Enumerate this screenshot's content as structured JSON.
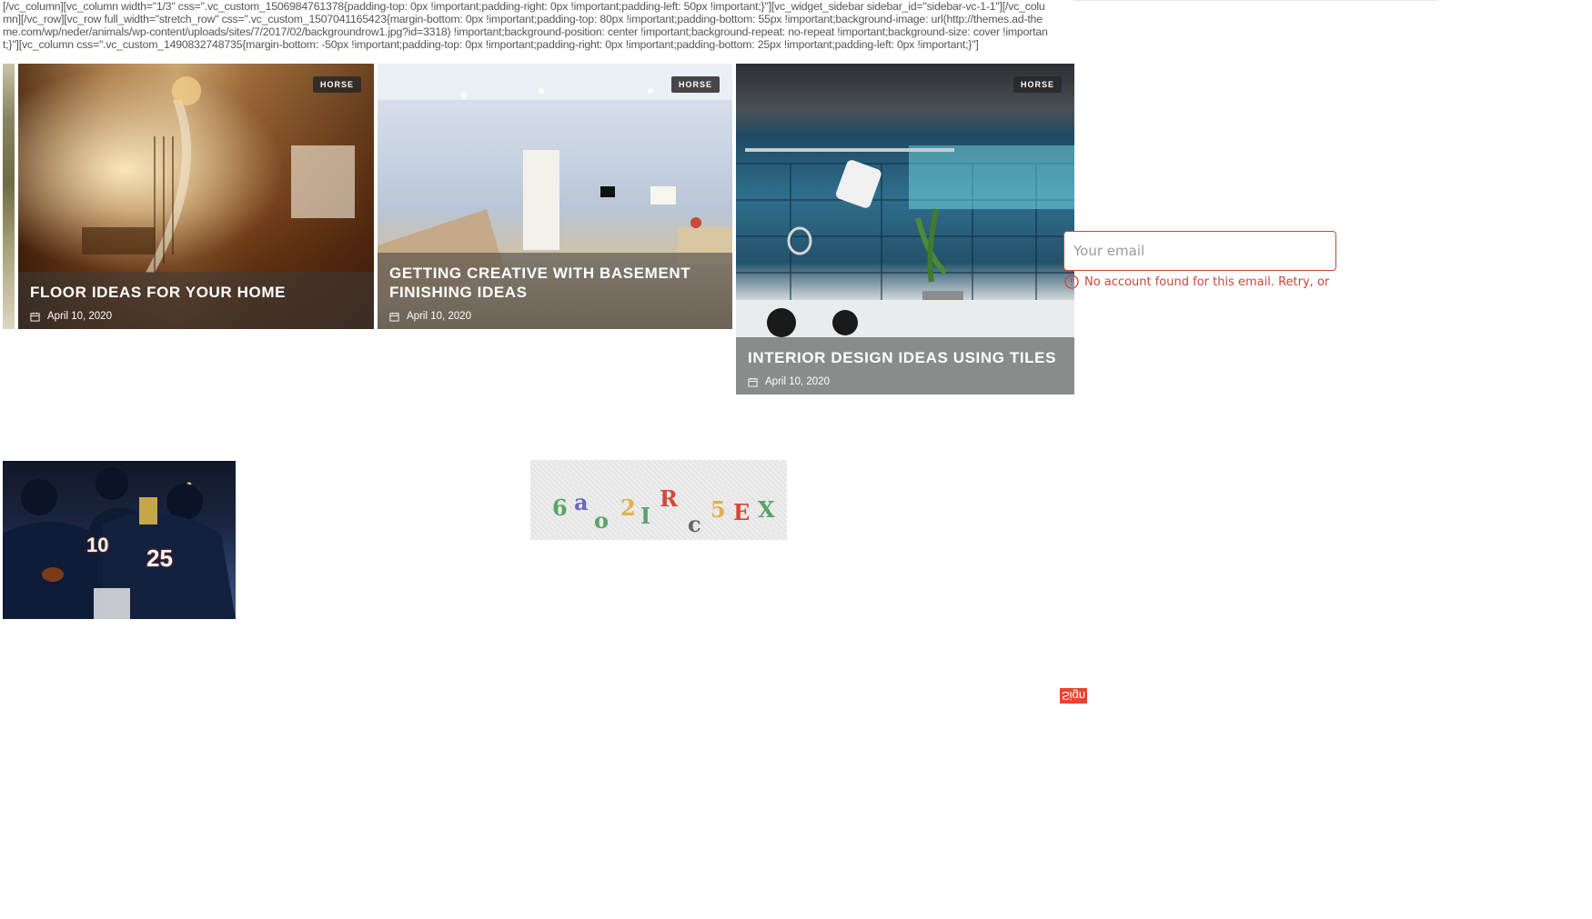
{
  "shortcode_text": "[/vc_column][vc_column width=\"1/3\" css=\".vc_custom_1506984761378{padding-top: 0px !important;padding-right: 0px !important;padding-left: 50px !important;}\"][vc_widget_sidebar sidebar_id=\"sidebar-vc-1-1\"][/vc_column][/vc_row][vc_row full_width=\"stretch_row\" css=\".vc_custom_1507041165423{margin-bottom: 0px !important;padding-top: 80px !important;padding-bottom: 55px !important;background-image: url(http://themes.ad-theme.com/wp/neder/animals/wp-content/uploads/sites/7/2017/02/backgroundrow1.jpg?id=3318) !important;background-position: center !important;background-repeat: no-repeat !important;background-size: cover !important;}\"][vc_column css=\".vc_custom_1490832748735{margin-bottom: -50px !important;padding-top: 0px !important;padding-right: 0px !important;padding-bottom: 25px !important;padding-left: 0px !important;}\"]",
  "cards": [
    {
      "tag": "HORSE",
      "title": "FLOOR IDEAS FOR YOUR HOME",
      "date": "April 10, 2020"
    },
    {
      "tag": "HORSE",
      "title": "GETTING CREATIVE WITH BASEMENT FINISHING IDEAS",
      "date": "April 10, 2020"
    },
    {
      "tag": "HORSE",
      "title": "INTERIOR DESIGN IDEAS USING TILES",
      "date": "April 10, 2020"
    }
  ],
  "email": {
    "placeholder": "Your email",
    "value": "",
    "error": "No account found for this email. Retry, or"
  },
  "captcha": {
    "characters": [
      "6",
      "a",
      "o",
      "2",
      "I",
      "R",
      "c",
      "5",
      "E",
      "X"
    ],
    "colors": [
      "#5aa36a",
      "#6b66c9",
      "#5aa36a",
      "#e2b04a",
      "#5aa36a",
      "#d8473a",
      "#666666",
      "#e2b04a",
      "#d8473a",
      "#5aa36a"
    ]
  },
  "photo_jersey_numbers": [
    "10",
    "25"
  ],
  "signup_label": "Sign",
  "colors": {
    "error": "#c9473a",
    "signup_bg": "#e8442e",
    "overlay": "rgba(60,60,60,0.55)"
  }
}
